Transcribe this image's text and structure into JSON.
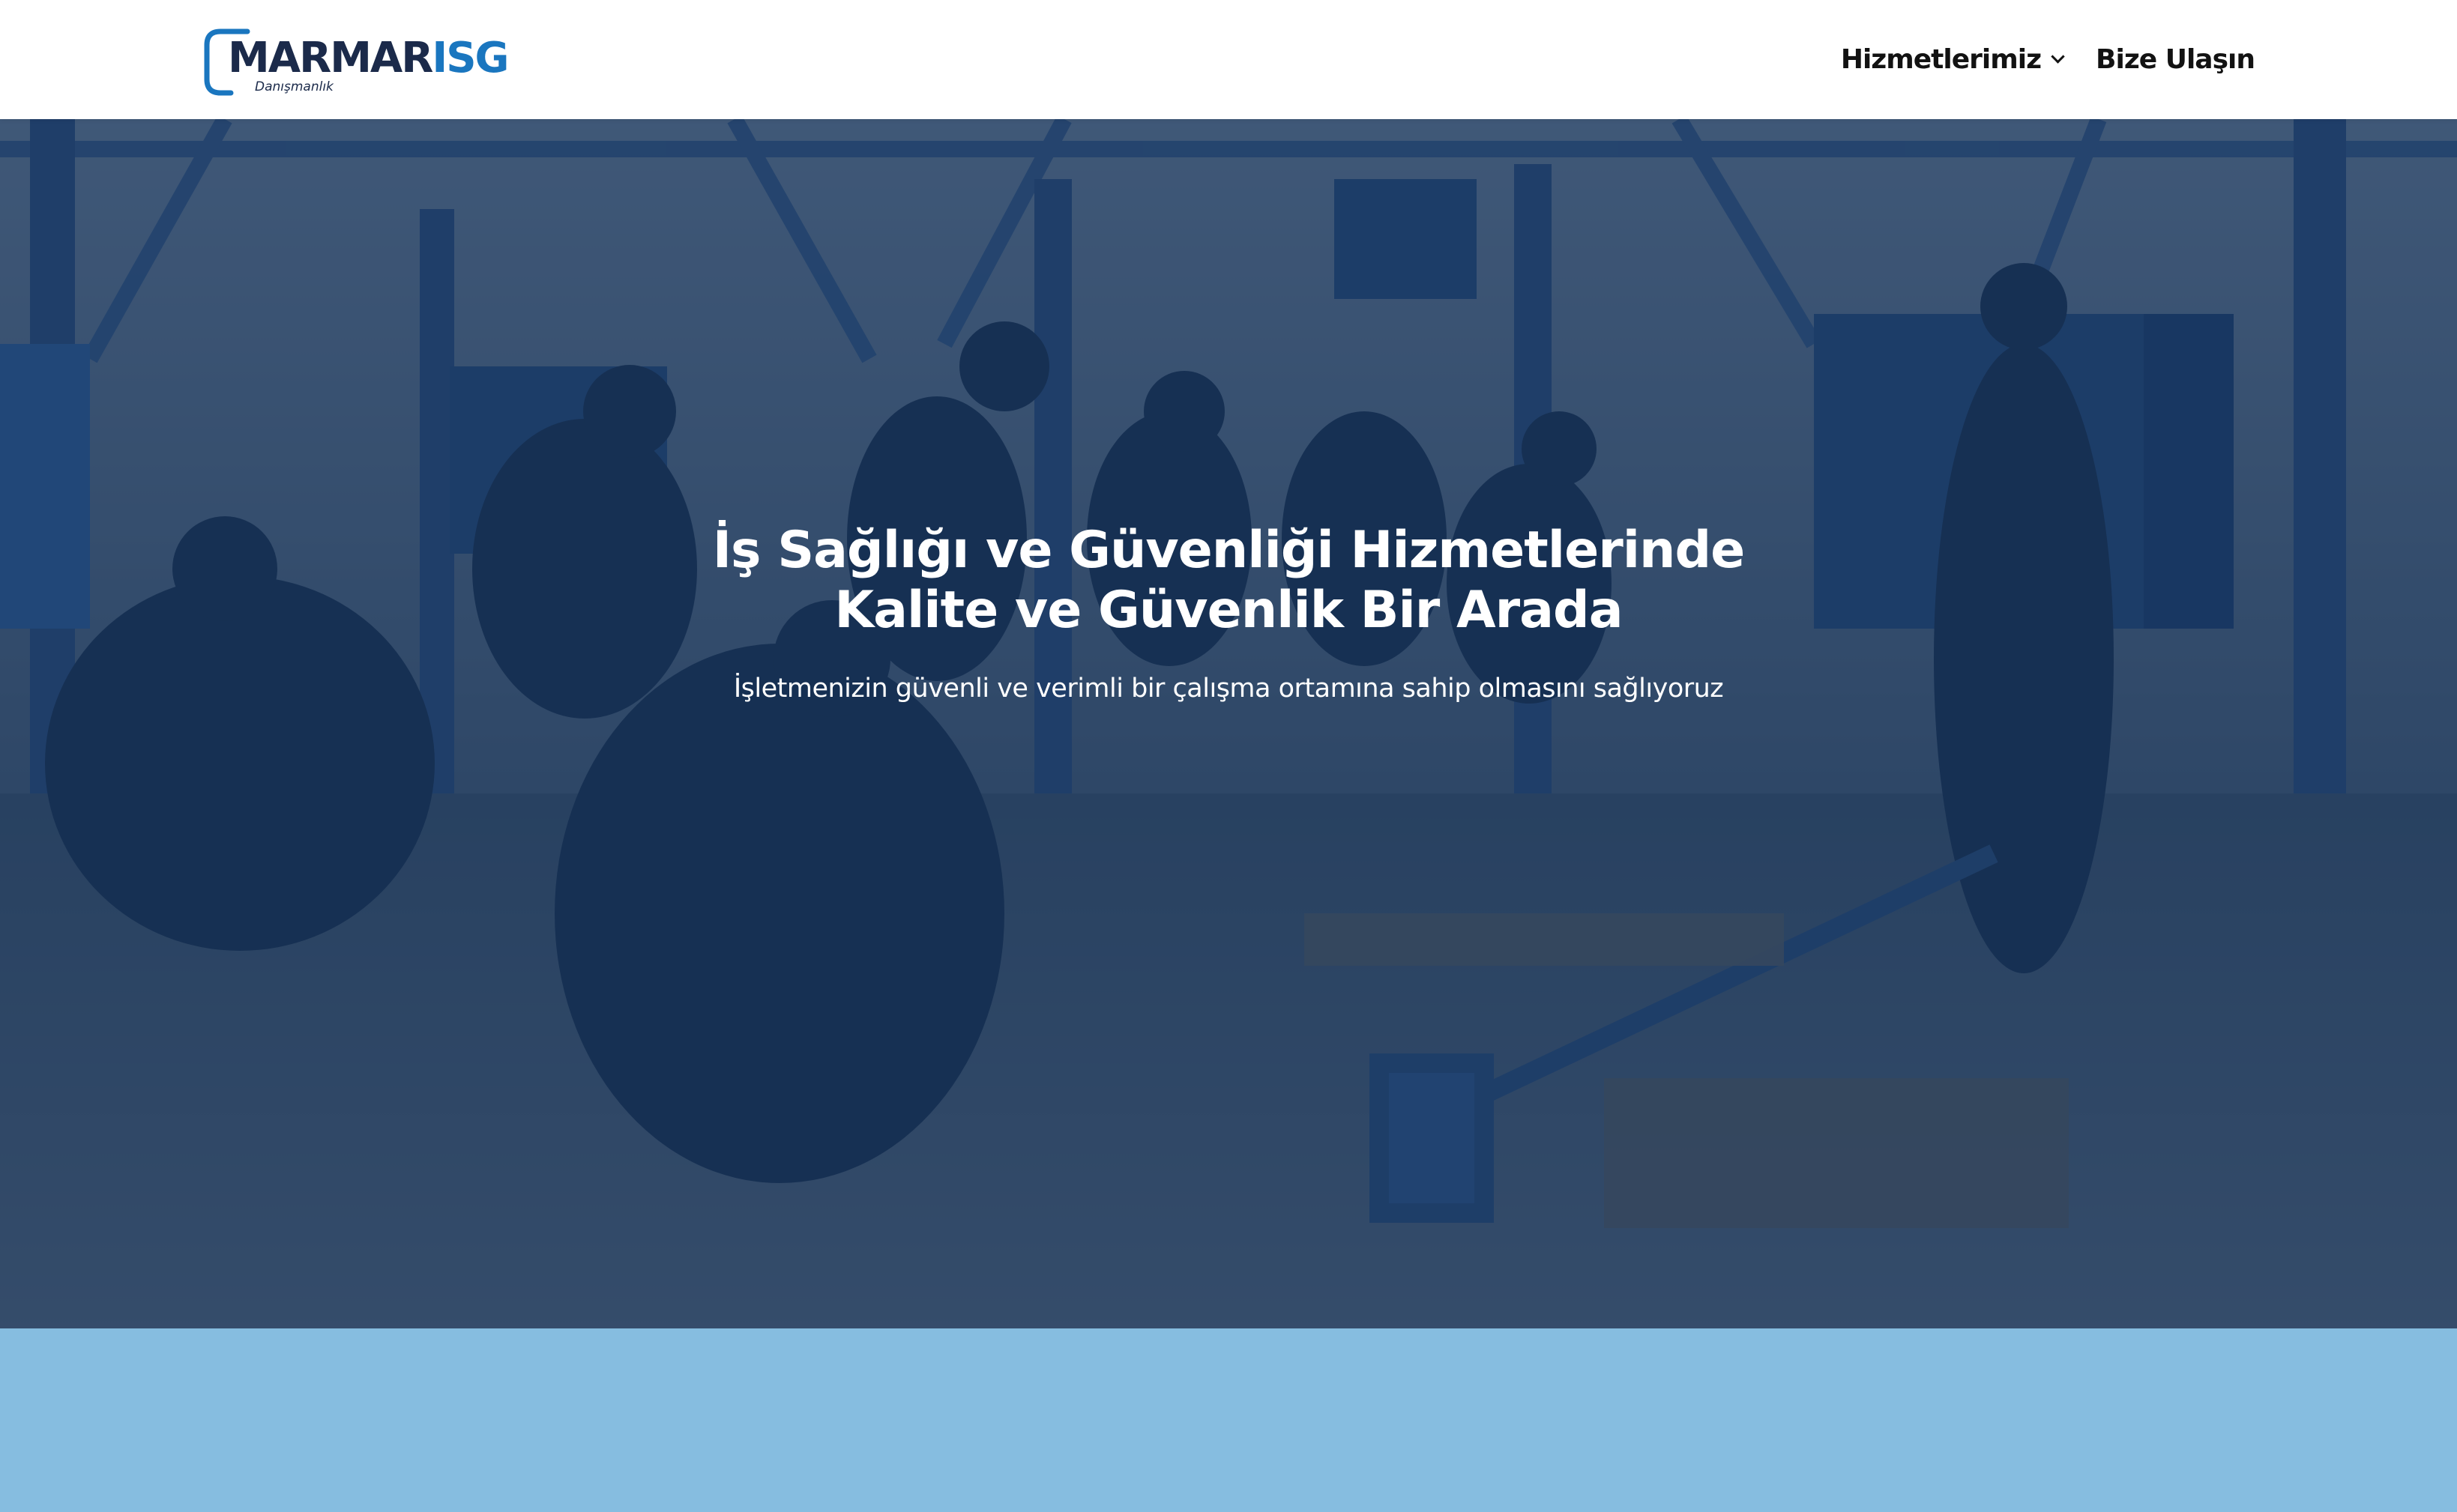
{
  "brand": {
    "logo_main": "MARMAR",
    "logo_accent": "ISG",
    "logo_tagline": "Danışmanlık"
  },
  "nav": {
    "items": [
      {
        "label": "Hizmetlerimiz",
        "has_dropdown": true
      },
      {
        "label": "Bize Ulaşın",
        "has_dropdown": false
      }
    ]
  },
  "hero": {
    "title_line1": "İş Sağlığı ve Güvenliği Hizmetlerinde",
    "title_line2": "Kalite ve Güvenlik Bir Arada",
    "subtitle": "İşletmenizin güvenli ve verimli bir çalışma ortamına sahip olmasını sağlıyoruz"
  },
  "colors": {
    "brand_dark": "#1b2a4a",
    "brand_blue": "#1a76bf",
    "hero_overlay": "#12325e",
    "band": "#86bde0"
  }
}
